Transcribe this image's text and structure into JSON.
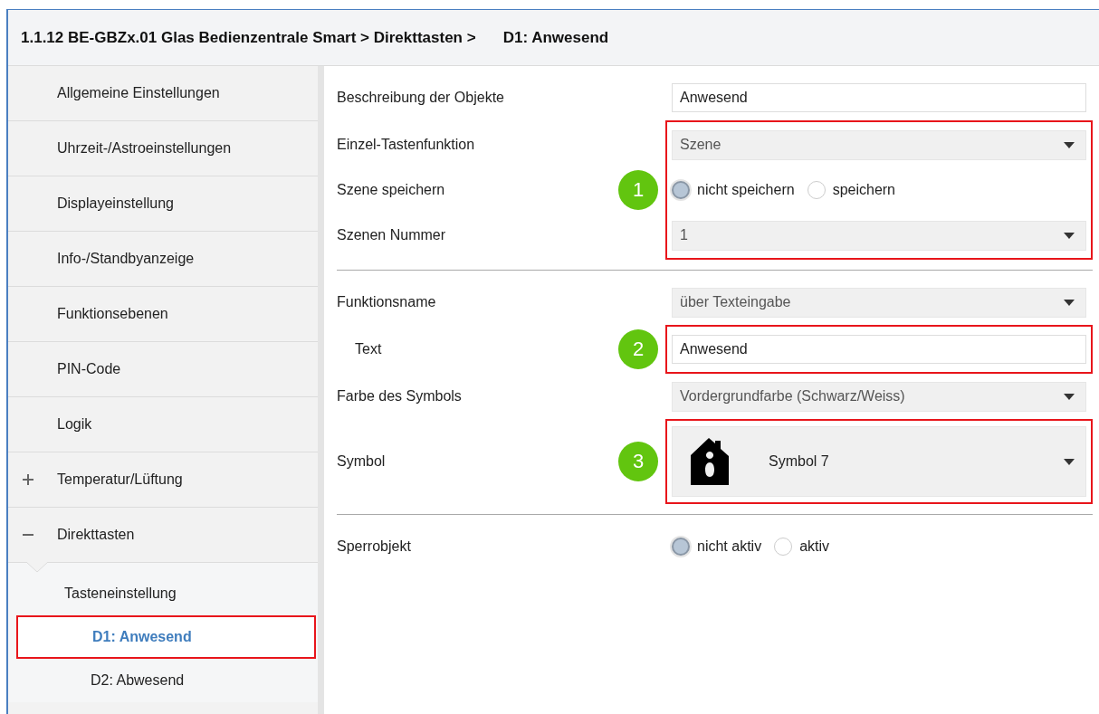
{
  "header": {
    "path": "1.1.12 BE-GBZx.01 Glas Bedienzentrale Smart > Direkttasten >",
    "current": "D1: Anwesend"
  },
  "sidebar": {
    "items": [
      {
        "label": "Allgemeine Einstellungen",
        "selected": false
      },
      {
        "label": "Uhrzeit-/Astroeinstellungen",
        "selected": false
      },
      {
        "label": "Displayeinstellung",
        "selected": false
      },
      {
        "label": "Info-/Standbyanzeige",
        "selected": false
      },
      {
        "label": "Funktionsebenen",
        "selected": false
      },
      {
        "label": "PIN-Code",
        "selected": false
      },
      {
        "label": "Logik",
        "selected": false
      },
      {
        "label": "Temperatur/Lüftung",
        "selected": false,
        "expanded": false
      },
      {
        "label": "Direkttasten",
        "selected": false,
        "expanded": true,
        "children": [
          {
            "label": "Tasteneinstellung",
            "selected": false,
            "children": [
              {
                "label": "D1: Anwesend",
                "selected": true
              },
              {
                "label": "D2: Abwesend",
                "selected": false
              }
            ]
          }
        ]
      }
    ]
  },
  "sections": [
    {
      "groups": [
        {
          "rows": [
            {
              "kind": "text",
              "label": "Beschreibung der Objekte",
              "value": "Anwesend"
            }
          ]
        },
        {
          "callout": "1",
          "rows": [
            {
              "kind": "dropdown",
              "label": "Einzel-Tastenfunktion",
              "value": "Szene"
            },
            {
              "kind": "radio",
              "label": "Szene speichern",
              "options": [
                {
                  "label": "nicht speichern",
                  "selected": true
                },
                {
                  "label": "speichern",
                  "selected": false
                }
              ]
            },
            {
              "kind": "dropdown",
              "label": "Szenen Nummer",
              "value": "1"
            }
          ]
        }
      ]
    },
    {
      "groups": [
        {
          "rows": [
            {
              "kind": "dropdown",
              "label": "Funktionsname",
              "value": "über Texteingabe"
            }
          ]
        },
        {
          "callout": "2",
          "rows": [
            {
              "kind": "text",
              "label": "Text",
              "indented": true,
              "value": "Anwesend"
            }
          ]
        },
        {
          "rows": [
            {
              "kind": "dropdown",
              "label": "Farbe des Symbols",
              "value": "Vordergrundfarbe (Schwarz/Weiss)"
            }
          ]
        },
        {
          "callout": "3",
          "rows": [
            {
              "kind": "symbol",
              "label": "Symbol",
              "value": "Symbol 7"
            }
          ]
        }
      ]
    },
    {
      "groups": [
        {
          "rows": [
            {
              "kind": "radio",
              "label": "Sperrobjekt",
              "options": [
                {
                  "label": "nicht aktiv",
                  "selected": true
                },
                {
                  "label": "aktiv",
                  "selected": false
                }
              ]
            }
          ]
        }
      ]
    }
  ]
}
